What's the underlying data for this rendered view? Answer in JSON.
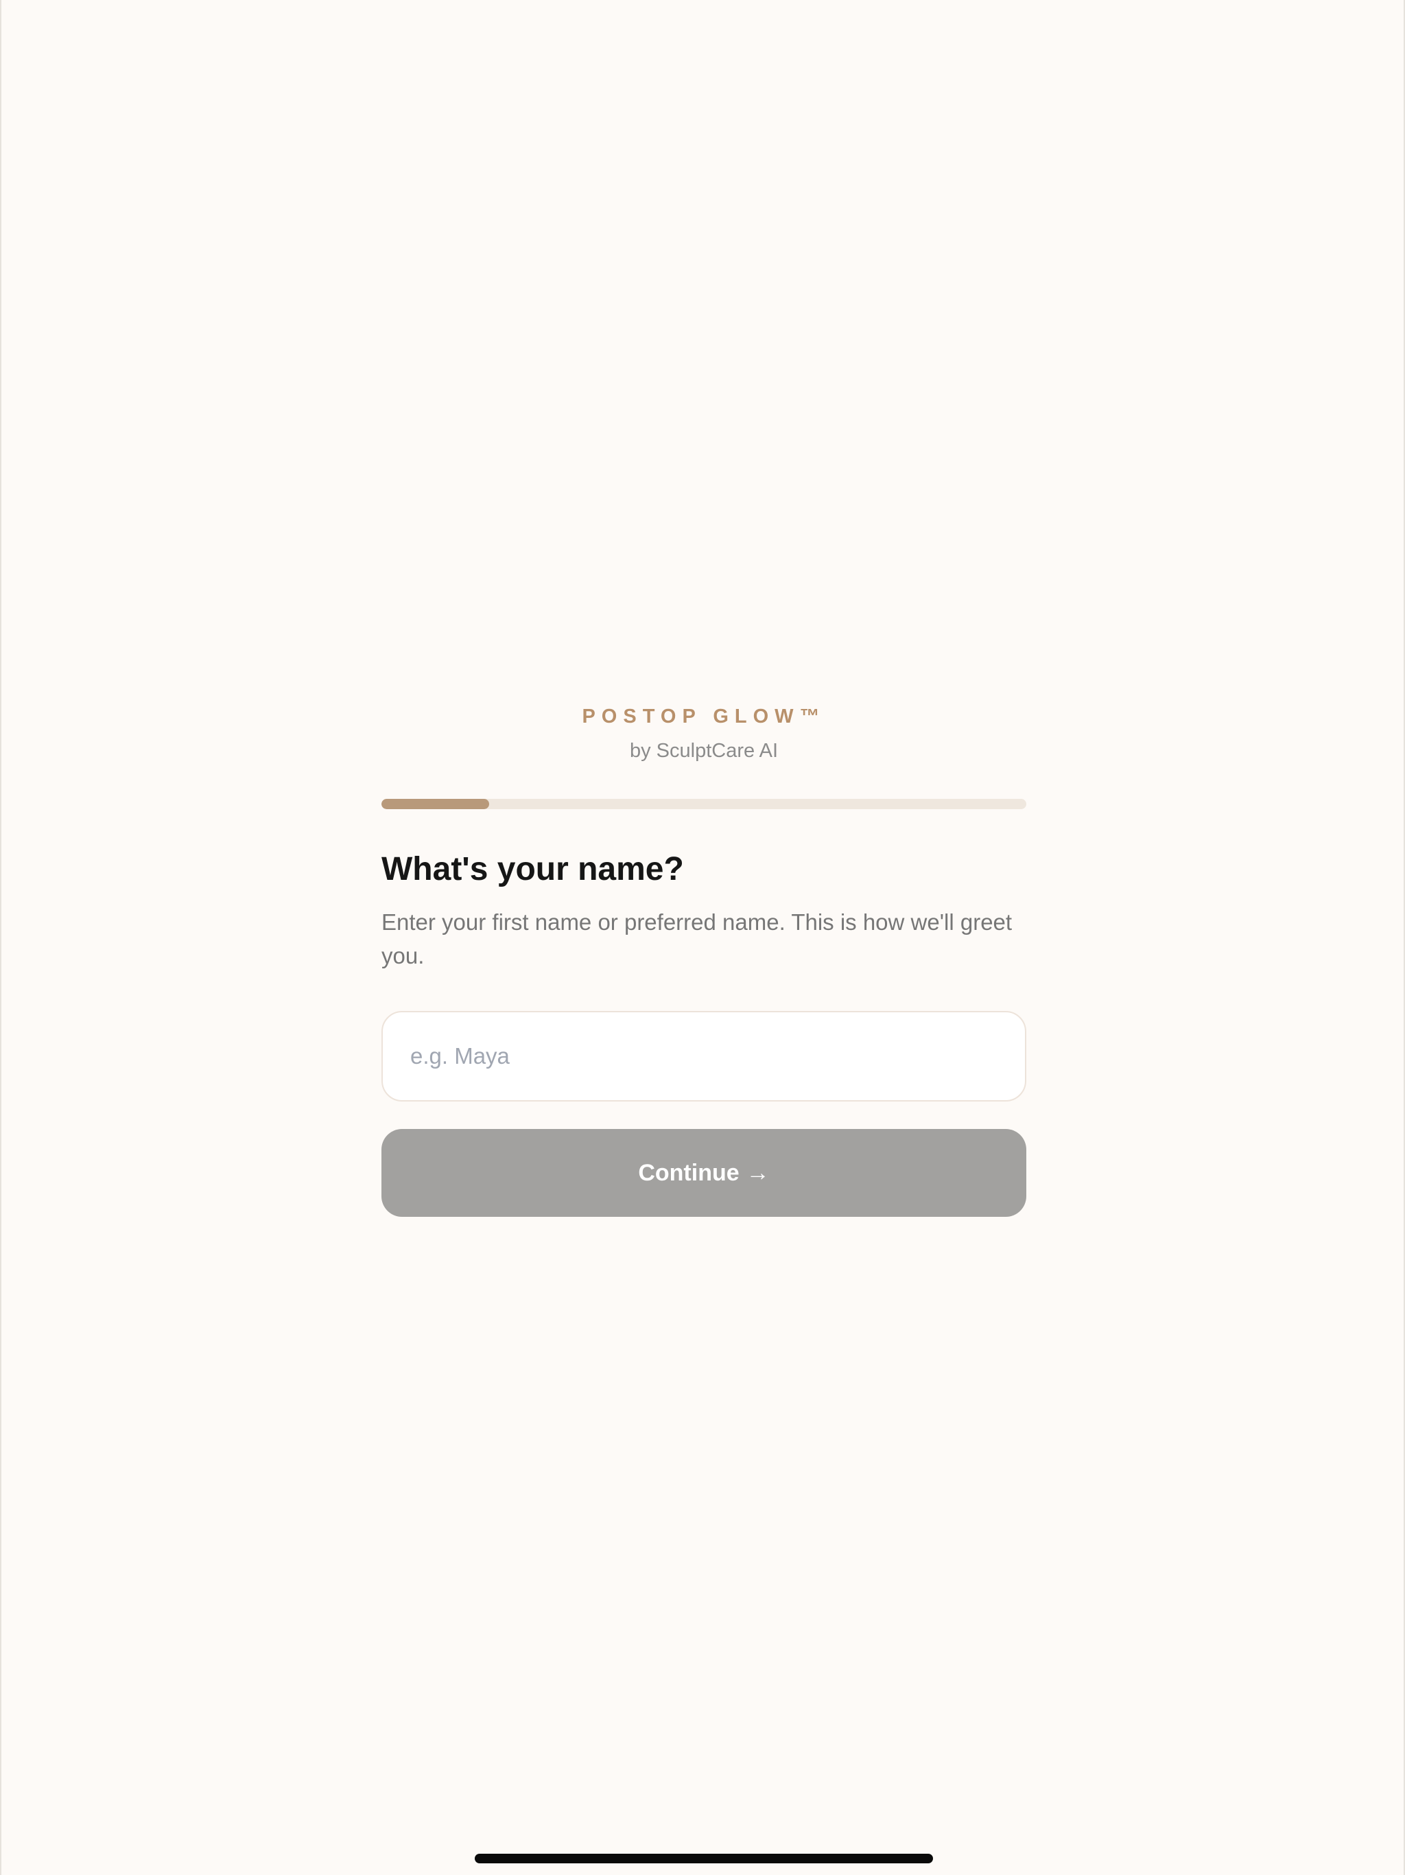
{
  "header": {
    "brand": "POSTOP GLOW™",
    "byline": "by SculptCare AI"
  },
  "progress": {
    "fraction": 0.167
  },
  "question": {
    "title": "What's your name?",
    "helper": "Enter your first name or preferred name. This is how we'll greet you."
  },
  "name_input": {
    "value": "",
    "placeholder": "e.g. Maya"
  },
  "continue_button": {
    "label": "Continue",
    "arrow": "→"
  },
  "colors": {
    "accent": "#b8906a",
    "progress_fill": "#b8997a",
    "progress_track": "#efe7de",
    "button_disabled": "#a2a19f",
    "background": "#fdfaf7"
  },
  "icons": {
    "continue_arrow": "arrow-right-icon"
  }
}
